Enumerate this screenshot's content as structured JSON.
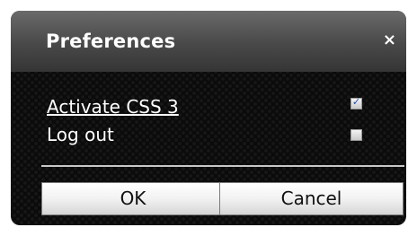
{
  "dialog": {
    "title": "Preferences",
    "close_symbol": "×",
    "close_icon": "close-icon"
  },
  "options": [
    {
      "label": "Activate CSS 3",
      "checked": true
    },
    {
      "label": "Log out",
      "checked": false
    }
  ],
  "buttons": {
    "ok_label": "OK",
    "cancel_label": "Cancel"
  },
  "colors": {
    "dialog_background": "#0b0b0b",
    "titlebar_top": "#6a6a6a",
    "titlebar_bottom": "#353535",
    "text": "#ffffff",
    "checkmark": "#2a4ea6"
  }
}
